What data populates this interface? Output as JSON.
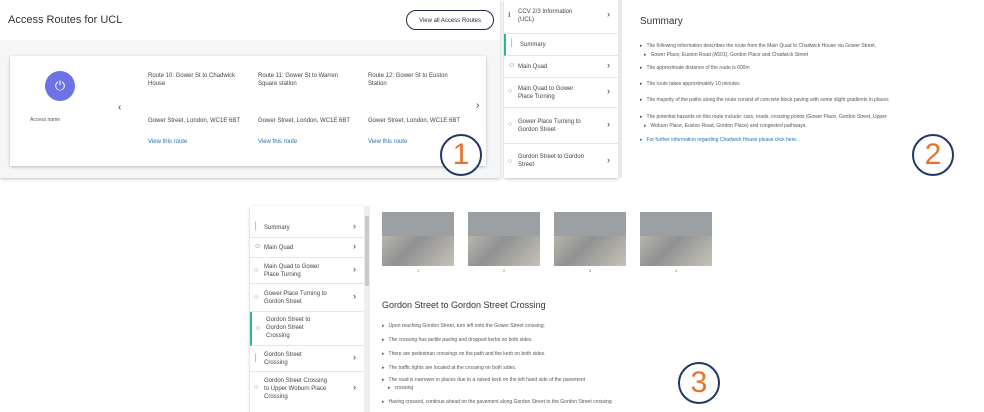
{
  "panel1": {
    "title": "Access Routes for UCL",
    "view_all_label": "View all Access Routes",
    "access_name": "Access name",
    "routes": [
      {
        "name": "Route 10: Gower St to Chadwick House",
        "address": "Gower Street, London, WC1E 6BT",
        "view": "View this route"
      },
      {
        "name": "Route 11: Gower St to Warren Square station",
        "address": "Gower Street, London, WC1E 6BT",
        "view": "View this route"
      },
      {
        "name": "Route 12: Gower St to Euston Station",
        "address": "Gower Street, London, WC1E 6BT",
        "view": "View this route"
      }
    ],
    "badge": "1"
  },
  "panel2": {
    "sidebar": [
      {
        "label": "CCV 2/3 Information (UCL)",
        "icon": "info-icon"
      },
      {
        "label": "Summary",
        "icon": "summary-icon",
        "active": true
      },
      {
        "label": "Main Quad",
        "icon": "person-icon"
      },
      {
        "label": "Main Quad to Gower Place Turning",
        "icon": "route-icon"
      },
      {
        "label": "Gower Place Turning to Gordon Street",
        "icon": "route-icon"
      },
      {
        "label": "Gordon Street to Gordon Street",
        "icon": "route-icon"
      }
    ],
    "summary_title": "Summary",
    "bullets": [
      "The following information describes the route from the Main Quad to Chadwick House via Gower Street,",
      "Gower Place, Euston Road (A501), Gordon Place and Chadwick Street",
      "The approximate distance of the route is 600m",
      "The route takes approximately 10 minutes",
      "The majority of the paths along the route consist of concrete block paving with some slight gradients in places",
      "The potential hazards on this route include: cars, roads, crossing points (Gower Place, Gordon Street, Upper",
      "Woburn Place, Euston Road, Gordon Place) and congested pathways.",
      "For further information regarding Chadwick House please click here."
    ],
    "badge": "2"
  },
  "panel3": {
    "sidebar": [
      {
        "label": "Summary",
        "icon": "summary-icon"
      },
      {
        "label": "Main Quad",
        "icon": "person-icon"
      },
      {
        "label": "Main Quad to Gower Place Turning",
        "icon": "route-icon"
      },
      {
        "label": "Gower Place Turning to Gordon Street",
        "icon": "route-icon"
      },
      {
        "label": "Gordon Street to Gordon Street Crossing",
        "icon": "route-icon",
        "active": true
      },
      {
        "label": "Gordon Street Crossing",
        "icon": "summary-icon"
      },
      {
        "label": "Gordon Street Crossing to Upper Woburn Place Crossing",
        "icon": "route-icon"
      }
    ],
    "photo_numbers": [
      "1",
      "2",
      "3",
      "4"
    ],
    "section_title": "Gordon Street to Gordon Street Crossing",
    "bullets": [
      "Upon reaching Gordon Street, turn left onto the Gower Street crossing.",
      "The crossing has tactile paving and dropped kerbs on both sides.",
      "There are pedestrian crossings on the path and the kerb on both sides.",
      "The traffic lights are located at the crossing on both sides.",
      "The road is narrower in places due to a raised kerb on the left hand side of the pavement",
      "crossing",
      "Having crossed, continue ahead on the pavement along Gordon Street to the Gordon Street crossing"
    ],
    "badge": "3"
  }
}
